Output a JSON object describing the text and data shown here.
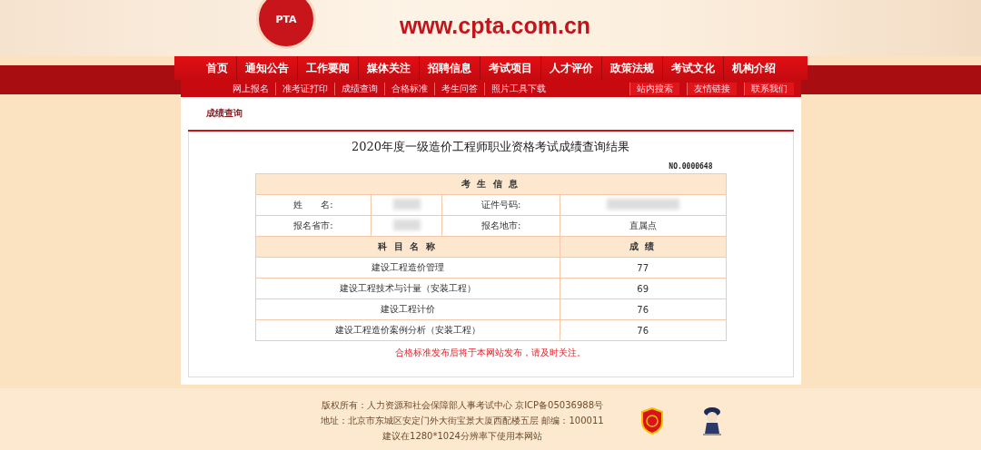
{
  "header": {
    "logo_text": "PTA",
    "url": "www.cpta.com.cn"
  },
  "main_nav": [
    {
      "label": "首页"
    },
    {
      "label": "通知公告"
    },
    {
      "label": "工作要闻"
    },
    {
      "label": "媒体关注"
    },
    {
      "label": "招聘信息"
    },
    {
      "label": "考试项目"
    },
    {
      "label": "人才评价"
    },
    {
      "label": "政策法规"
    },
    {
      "label": "考试文化"
    },
    {
      "label": "机构介绍"
    }
  ],
  "sub_nav": [
    {
      "label": "网上报名"
    },
    {
      "label": "准考证打印"
    },
    {
      "label": "成绩查询"
    },
    {
      "label": "合格标准"
    },
    {
      "label": "考生问答"
    },
    {
      "label": "照片工具下载"
    }
  ],
  "quick_links": [
    {
      "label": "站内搜索"
    },
    {
      "label": "友情链接"
    },
    {
      "label": "联系我们"
    }
  ],
  "section_title": "成绩查询",
  "result": {
    "title": "2020年度一级造价工程师职业资格考试成绩查询结果",
    "number": "NO.0000648",
    "info_heading": "考 生 信 息",
    "info_rows": [
      [
        {
          "label": "姓　　名:"
        },
        {
          "label": "证件号码:"
        }
      ],
      [
        {
          "label": "报名省市:"
        },
        {
          "label": "报名地市:",
          "value": "直属点"
        }
      ]
    ],
    "score_columns": [
      "科 目 名 称",
      "成 绩"
    ],
    "scores": [
      {
        "subject": "建设工程造价管理",
        "score": "77"
      },
      {
        "subject": "建设工程技术与计量（安装工程）",
        "score": "69"
      },
      {
        "subject": "建设工程计价",
        "score": "76"
      },
      {
        "subject": "建设工程造价案例分析（安装工程）",
        "score": "76"
      }
    ],
    "notice": "合格标准发布后将于本网站发布，请及时关注。"
  },
  "footer": {
    "lines": [
      "版权所有：人力资源和社会保障部人事考试中心  京ICP备05036988号",
      "地址：北京市东城区安定门外大街宝景大厦西配楼五层  邮编：100011",
      "建议在1280*1024分辨率下使用本网站"
    ]
  }
}
